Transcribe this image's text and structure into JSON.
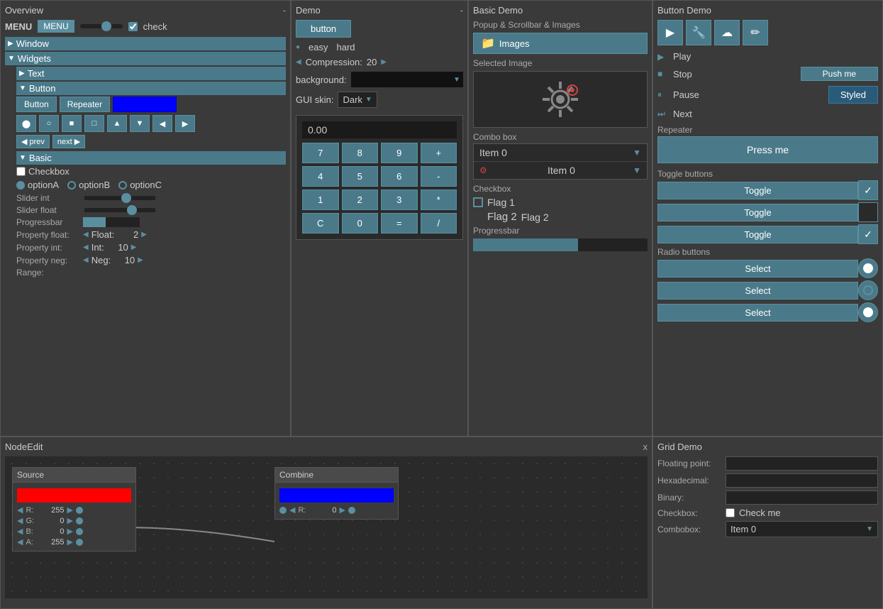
{
  "overview": {
    "title": "Overview",
    "close": "-",
    "menu_label": "MENU",
    "menu_btn": "MENU",
    "check_label": "check",
    "window_label": "Window",
    "widgets_label": "Widgets",
    "text_label": "Text",
    "button_label": "Button",
    "buttons": {
      "button": "Button",
      "repeater": "Repeater",
      "blue": ""
    },
    "prev_label": "prev",
    "next_label": "next",
    "basic_label": "Basic",
    "checkbox_label": "Checkbox",
    "option_a": "optionA",
    "option_b": "optionB",
    "option_c": "optionC",
    "slider_int_label": "Slider int",
    "slider_float_label": "Slider float",
    "progressbar_label": "Progressbar",
    "property_float_label": "Property float:",
    "float_label": "Float:",
    "float_val": "2",
    "property_int_label": "Property int:",
    "int_label": "Int:",
    "int_val": "10",
    "property_neg_label": "Property neg:",
    "neg_label": "Neg:",
    "neg_val": "10",
    "range_label": "Range:"
  },
  "demo": {
    "title": "Demo",
    "close": "-",
    "button_label": "button",
    "easy_label": "easy",
    "hard_label": "hard",
    "compression_label": "Compression:",
    "compression_val": "20",
    "background_label": "background:",
    "gui_skin_label": "GUI skin:",
    "gui_skin_val": "Dark",
    "calc_display": "0.00",
    "calc_buttons": [
      "7",
      "8",
      "9",
      "+",
      "4",
      "5",
      "6",
      "-",
      "1",
      "2",
      "3",
      "*",
      "C",
      "0",
      "=",
      "/"
    ]
  },
  "basic_demo": {
    "title": "Basic Demo",
    "close": "",
    "popup_label": "Popup & Scrollbar & Images",
    "images_label": "Images",
    "selected_image_label": "Selected Image",
    "combo_box_label": "Combo box",
    "item0": "Item 0",
    "item1": "Item 0",
    "checkbox_label": "Checkbox",
    "flag1_label": "Flag 1",
    "flag2_label": "Flag 2",
    "progressbar_label": "Progressbar"
  },
  "button_demo": {
    "title": "Button Demo",
    "icons": [
      "▶",
      "🔧",
      "☁",
      "✏"
    ],
    "play_label": "Play",
    "stop_label": "Stop",
    "pause_label": "Pause",
    "next_label": "Next",
    "push_me_label": "Press me",
    "styled_label": "Styled",
    "repeater_label": "Repeater",
    "toggle_label": "Toggle buttons",
    "toggle1": "Toggle",
    "toggle2": "Toggle",
    "toggle3": "Toggle",
    "radio_label": "Radio buttons",
    "select1": "Select",
    "select2": "Select",
    "select3": "Select"
  },
  "nodeedit": {
    "title": "NodeEdit",
    "close": "x",
    "source_label": "Source",
    "r_label": "R:",
    "r_val": "255",
    "g_label": "G:",
    "g_val": "0",
    "b_label": "B:",
    "b_val": "0",
    "a_label": "A:",
    "a_val": "255",
    "combine_label": "Combine",
    "combine_r_label": "R:",
    "combine_r_val": "0"
  },
  "grid_demo": {
    "title": "Grid Demo",
    "floating_point_label": "Floating point:",
    "hexadecimal_label": "Hexadecimal:",
    "binary_label": "Binary:",
    "checkbox_label": "Checkbox:",
    "check_me_label": "Check me",
    "combobox_label": "Combobox:",
    "combobox_val": "Item 0"
  }
}
